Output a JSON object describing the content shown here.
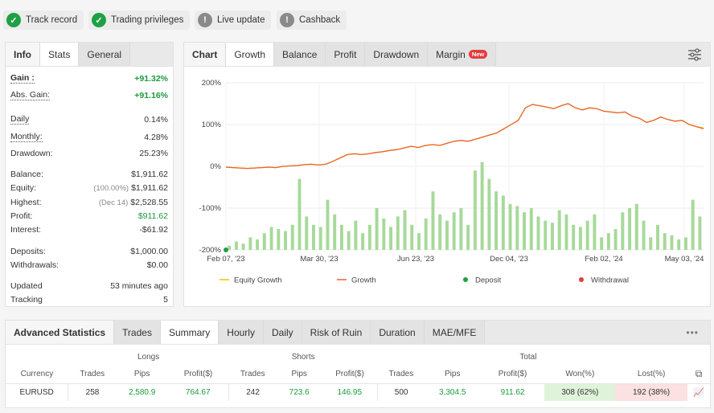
{
  "badges": [
    {
      "label": "Track record",
      "icon": "check-icon",
      "status": "ok"
    },
    {
      "label": "Trading privileges",
      "icon": "check-icon",
      "status": "ok"
    },
    {
      "label": "Live update",
      "icon": "exclamation-icon",
      "status": "warn"
    },
    {
      "label": "Cashback",
      "icon": "exclamation-icon",
      "status": "warn"
    }
  ],
  "info_panel": {
    "tabs": [
      "Info",
      "Stats",
      "General"
    ],
    "active_tab": "Stats",
    "rows": {
      "gain": {
        "label": "Gain :",
        "value": "+91.32%"
      },
      "abs_gain": {
        "label": "Abs. Gain:",
        "value": "+91.16%"
      },
      "daily": {
        "label": "Daily",
        "value": "0.14%"
      },
      "monthly": {
        "label": "Monthly:",
        "value": "4.28%"
      },
      "drawdown": {
        "label": "Drawdown:",
        "value": "25.23%"
      },
      "balance": {
        "label": "Balance:",
        "value": "$1,911.62"
      },
      "equity": {
        "label": "Equity:",
        "note": "(100.00%)",
        "value": "$1,911.62"
      },
      "highest": {
        "label": "Highest:",
        "note": "(Dec 14)",
        "value": "$2,528.55"
      },
      "profit": {
        "label": "Profit:",
        "value": "$911.62"
      },
      "interest": {
        "label": "Interest:",
        "value": "-$61.92"
      },
      "deposits": {
        "label": "Deposits:",
        "value": "$1,000.00"
      },
      "withdrawals": {
        "label": "Withdrawals:",
        "value": "$0.00"
      },
      "updated": {
        "label": "Updated",
        "value": "53 minutes ago"
      },
      "tracking": {
        "label": "Tracking",
        "value": "5"
      }
    }
  },
  "chart_panel": {
    "title": "Chart",
    "tabs": [
      "Growth",
      "Balance",
      "Profit",
      "Drawdown",
      "Margin"
    ],
    "active_tab": "Growth",
    "new_badge": "New"
  },
  "chart_data": {
    "type": "line",
    "x_ticks": [
      "Feb 07, '23",
      "Mar 30, '23",
      "Jun 23, '23",
      "Dec 04, '23",
      "Feb 02, '24",
      "May 03, '24"
    ],
    "y_ticks": [
      "200%",
      "100%",
      "0%",
      "-100%",
      "-200%"
    ],
    "ylim": [
      -200,
      200
    ],
    "legend": [
      "Equity Growth",
      "Growth",
      "Deposit",
      "Withdrawal"
    ],
    "colors": {
      "equity": "#f0c000",
      "growth": "#e8622a",
      "bars": "#a7d99a",
      "deposit": "#1fa045",
      "withdrawal": "#e43c3c"
    },
    "series": [
      {
        "name": "Growth",
        "values": [
          -2,
          -3,
          -4,
          -5,
          -4,
          -3,
          -2,
          -3,
          0,
          1,
          2,
          4,
          5,
          3,
          5,
          12,
          20,
          28,
          30,
          28,
          30,
          33,
          35,
          38,
          40,
          44,
          48,
          45,
          50,
          52,
          50,
          55,
          60,
          62,
          60,
          65,
          70,
          75,
          80,
          90,
          100,
          110,
          140,
          148,
          145,
          142,
          138,
          145,
          150,
          140,
          135,
          140,
          138,
          132,
          130,
          128,
          130,
          120,
          115,
          105,
          110,
          118,
          112,
          108,
          110,
          100,
          95,
          90
        ]
      },
      {
        "name": "Equity Growth",
        "values": [
          -2,
          -3,
          -4,
          -5,
          -4,
          -3,
          -2,
          -3,
          0,
          1,
          2,
          4,
          5,
          3,
          5,
          12,
          20,
          28,
          30,
          28,
          30,
          33,
          35,
          38,
          40,
          44,
          48,
          45,
          50,
          52,
          50,
          55,
          60,
          62,
          60,
          65,
          70,
          75,
          80,
          90,
          100,
          110,
          140,
          148,
          145,
          142,
          138,
          145,
          150,
          140,
          135,
          140,
          138,
          132,
          130,
          128,
          130,
          120,
          115,
          105,
          110,
          118,
          112,
          108,
          110,
          100,
          95,
          92
        ]
      }
    ],
    "bars": [
      10,
      20,
      15,
      30,
      25,
      40,
      55,
      50,
      45,
      60,
      170,
      80,
      60,
      55,
      120,
      85,
      60,
      45,
      70,
      40,
      60,
      100,
      75,
      55,
      80,
      95,
      60,
      40,
      75,
      140,
      85,
      70,
      90,
      100,
      60,
      190,
      210,
      170,
      140,
      130,
      110,
      105,
      90,
      100,
      80,
      70,
      65,
      95,
      85,
      60,
      55,
      70,
      85,
      30,
      40,
      50,
      90,
      100,
      110,
      70,
      30,
      60,
      40,
      35,
      25,
      30,
      120,
      80
    ]
  },
  "advanced": {
    "title": "Advanced Statistics",
    "tabs": [
      "Trades",
      "Summary",
      "Hourly",
      "Daily",
      "Risk of Ruin",
      "Duration",
      "MAE/MFE"
    ],
    "active_tab": "Summary",
    "groups": [
      "Longs",
      "Shorts",
      "Total"
    ],
    "headers": [
      "Currency",
      "Trades",
      "Pips",
      "Profit($)",
      "Trades",
      "Pips",
      "Profit($)",
      "Trades",
      "Pips",
      "Profit($)",
      "Won(%)",
      "Lost(%)"
    ],
    "row": [
      "EURUSD",
      "258",
      "2,580.9",
      "764.67",
      "242",
      "723.6",
      "146.95",
      "500",
      "3,304.5",
      "911.62",
      "308 (62%)",
      "192 (38%)"
    ]
  }
}
